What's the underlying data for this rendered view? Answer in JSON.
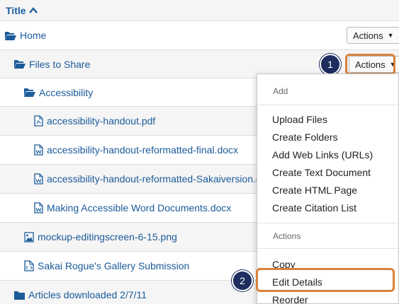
{
  "header": {
    "title": "Title"
  },
  "rows": [
    {
      "label": "Home",
      "icon": "folder-open-icon"
    },
    {
      "label": "Files to Share",
      "icon": "folder-open-icon"
    },
    {
      "label": "Accessibility",
      "icon": "folder-open-icon"
    },
    {
      "label": "accessibility-handout.pdf",
      "icon": "pdf-file-icon"
    },
    {
      "label": "accessibility-handout-reformatted-final.docx",
      "icon": "word-file-icon"
    },
    {
      "label": "accessibility-handout-reformatted-Sakaiversion.docx",
      "icon": "word-file-icon"
    },
    {
      "label": "Making Accessible Word Documents.docx",
      "icon": "word-file-icon"
    },
    {
      "label": "mockup-editingscreen-6-15.png",
      "icon": "image-file-icon"
    },
    {
      "label": "Sakai Rogue's Gallery Submission",
      "icon": "code-file-icon"
    },
    {
      "label": "Articles downloaded 2/7/11",
      "icon": "folder-closed-icon"
    }
  ],
  "actions": {
    "home_label": "Actions",
    "files_label": "Actions"
  },
  "steps": {
    "one": "1",
    "two": "2"
  },
  "menu": {
    "add_header": "Add",
    "add_items": [
      "Upload Files",
      "Create Folders",
      "Add Web Links (URLs)",
      "Create Text Document",
      "Create HTML Page",
      "Create Citation List"
    ],
    "actions_header": "Actions",
    "action_items": [
      "Copy",
      "Edit Details",
      "Reorder"
    ]
  },
  "colors": {
    "link": "#1b5b9a",
    "highlight": "#d9823b",
    "step_badge": "#1c2d5e"
  }
}
